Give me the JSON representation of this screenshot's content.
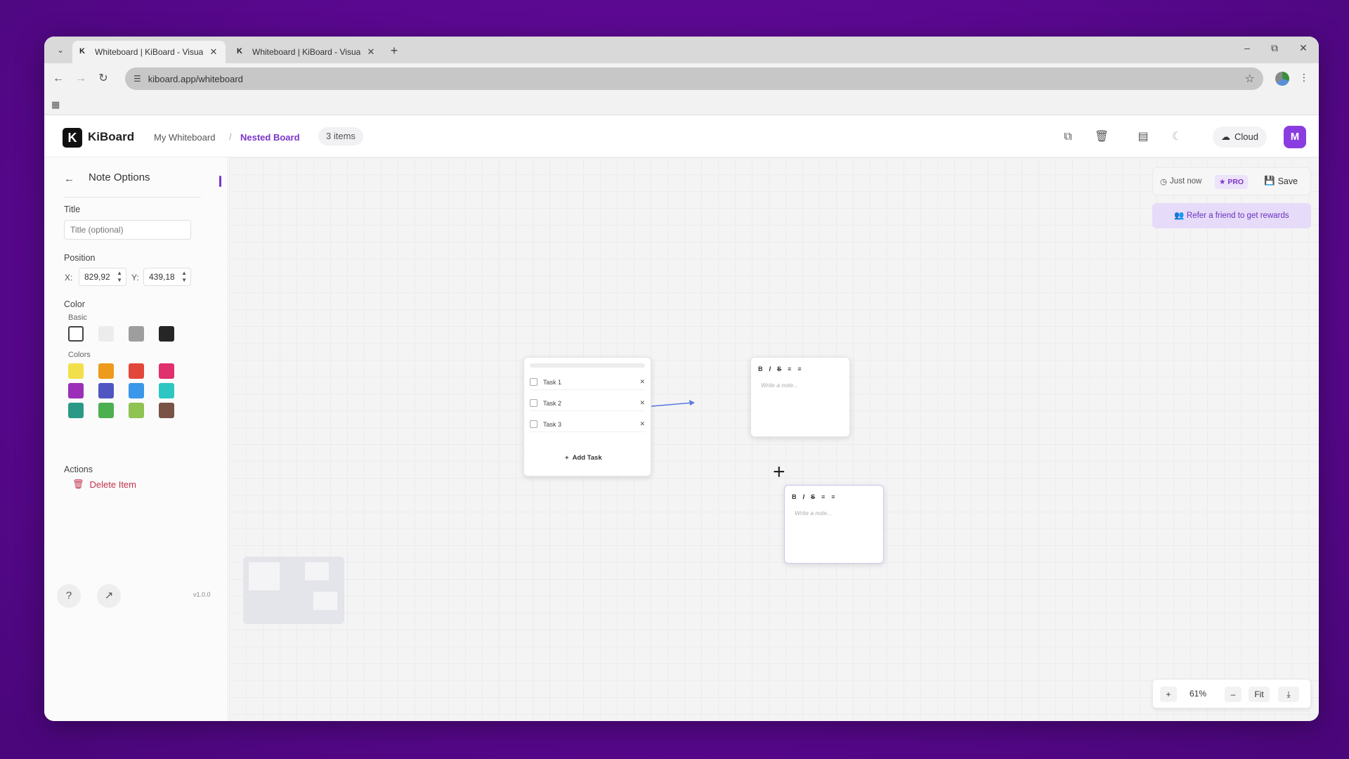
{
  "browser": {
    "tabs": [
      {
        "title": "Whiteboard | KiBoard - Visual C",
        "favicon": "K",
        "active": true
      },
      {
        "title": "Whiteboard | KiBoard - Visual C",
        "favicon": "K",
        "active": false
      }
    ],
    "url": "kiboard.app/whiteboard"
  },
  "app": {
    "logo_letter": "K",
    "brand": "KiBoard",
    "breadcrumb": [
      "My Whiteboard",
      "Nested Board"
    ],
    "breadcrumb_sep": "/",
    "item_count": "3 items",
    "cloud_label": "Cloud",
    "avatar_letter": "M",
    "accent_color": "#7a35c8"
  },
  "sidebar": {
    "title": "Note Options",
    "title_label": "Title",
    "title_placeholder": "Title (optional)",
    "position_label": "Position",
    "x_label": "X:",
    "y_label": "Y:",
    "x_value": "829,92",
    "y_value": "439,18",
    "color_label": "Color",
    "basic_label": "Basic",
    "colors_label": "Colors",
    "basic_colors": [
      "#ffffff",
      "#ececec",
      "#9e9e9e",
      "#262626"
    ],
    "colors": [
      "#f2e04a",
      "#ee9a1c",
      "#e2473b",
      "#e0306e",
      "#9b2fb7",
      "#4f56c2",
      "#3a97ea",
      "#2ec6c2",
      "#2a9a86",
      "#4cb050",
      "#8fc352",
      "#7a5347"
    ],
    "actions_label": "Actions",
    "delete_label": "Delete Item",
    "version": "v1.0.0"
  },
  "canvas": {
    "todo": {
      "tasks": [
        "Task 1",
        "Task 2",
        "Task 3"
      ],
      "add_label": "Add Task"
    },
    "note_toolbar": [
      "B",
      "I",
      "S",
      "≡",
      "≡"
    ],
    "note_placeholder": "Write a note..."
  },
  "status": {
    "saved": "Just now",
    "pro": "PRO",
    "save": "Save",
    "refer": "Refer a friend to get rewards"
  },
  "zoom": {
    "value": "61%",
    "fit": "Fit"
  }
}
